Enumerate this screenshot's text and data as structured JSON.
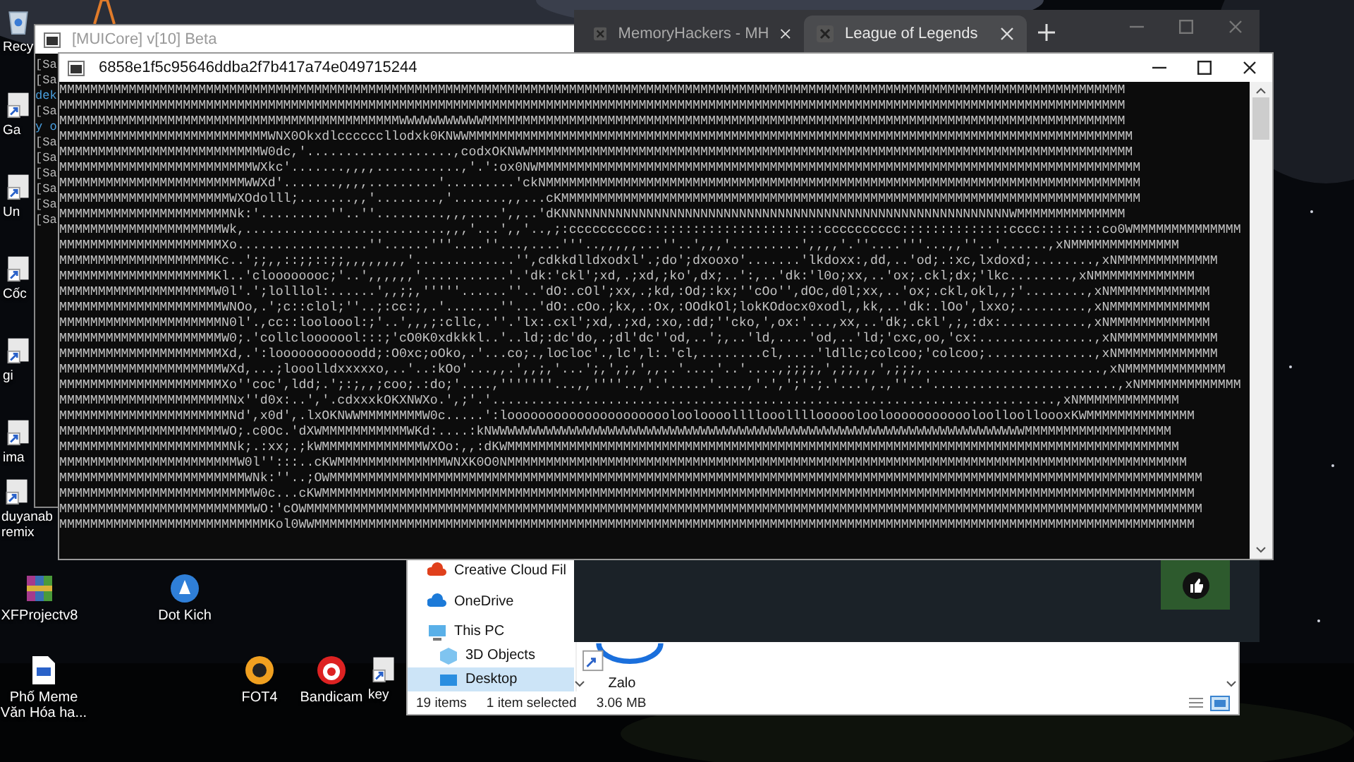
{
  "desktop": {
    "icons": [
      {
        "kind": "outline"
      },
      {
        "label": "Recy",
        "kind": "bin"
      },
      {
        "label": "Ga",
        "kind": "shortcut"
      },
      {
        "label": "Un",
        "kind": "shortcut"
      },
      {
        "label": "Cốc",
        "kind": "shortcut"
      },
      {
        "label": "gi",
        "kind": "shortcut"
      },
      {
        "label": "ima",
        "kind": "shortcut"
      },
      {
        "label": "duyanab remix",
        "kind": "shortcut"
      },
      {
        "label": "XFProjectv8",
        "kind": "archive"
      },
      {
        "label": "Dot Kich",
        "kind": "globe"
      },
      {
        "label": "Phố Meme Văn Hóa ha...",
        "kind": "document"
      },
      {
        "label": "FOT4",
        "kind": "circle"
      },
      {
        "label": "Bandicam",
        "kind": "record"
      },
      {
        "label": "key",
        "kind": "shortcut"
      }
    ]
  },
  "background_console": {
    "title": "[MUICore] v[10] Beta",
    "lines": [
      {
        "text": "[Sa",
        "kind": "log"
      },
      {
        "text": "[Sa",
        "kind": "log"
      },
      {
        "text": "dek",
        "kind": "info"
      },
      {
        "text": "[Sa",
        "kind": "log"
      },
      {
        "text": "y o",
        "kind": "info"
      },
      {
        "text": "[Sa",
        "kind": "log"
      },
      {
        "text": "[Sa",
        "kind": "log"
      },
      {
        "text": "[Sa",
        "kind": "log"
      },
      {
        "text": "[Sa",
        "kind": "log"
      },
      {
        "text": "[Sa",
        "kind": "log"
      },
      {
        "text": "[Sa",
        "kind": "log"
      }
    ]
  },
  "browser": {
    "tabs": [
      {
        "title": "MemoryHackers - MH",
        "selected": false
      },
      {
        "title": "League of Legends",
        "selected": true
      }
    ]
  },
  "explorer": {
    "nav_items": [
      {
        "label": "Creative Cloud Fil",
        "kind": "creative",
        "selected": false
      },
      {
        "label": "OneDrive",
        "kind": "onedrive",
        "selected": false
      },
      {
        "label": "This PC",
        "kind": "pc",
        "selected": false
      },
      {
        "label": "3D Objects",
        "kind": "objects",
        "selected": false
      },
      {
        "label": "Desktop",
        "kind": "desktop",
        "selected": true
      }
    ],
    "files": [
      {
        "name": "Zalo"
      }
    ],
    "status_bar": {
      "item_count": "19 items",
      "selection": "1 item selected",
      "size": "3.06 MB"
    }
  },
  "console": {
    "title": "6858e1f5c95646ddba2f7b417a74e049715244",
    "lines": [
      "MMMMMMMMMMMMMMMMMMMMMMMMMMMMMMMMMMMMMMMMMMMMMMMMMMMMMMMMMMMMMMMMMMMMMMMMMMMMMMMMMMMMMMMMMMMMMMMMMMMMMMMMMMMMMMMMMMMMMMMMMMMMMMMMMMMMMMMMMM",
      "MMMMMMMMMMMMMMMMMMMMMMMMMMMMMMMMMMMMMMMMMMMMMMMMMMMMMMMMMMMMMMMMMMMMMMMMMMMMMMMMMMMMMMMMMMMMMMMMMMMMMMMMMMMMMMMMMMMMMMMMMMMMMMMMMMMMMMMMMM",
      "MMMMMMMMMMMMMMMMMMMMMMMMMMMMMMMMMMMMMMMMMMMMWWWWWWWWWWWMMMMMMMMMMMMMMMMMMMMMMMMMMMMMMMMMMMMMMMMMMMMMMMMMMMMMMMMMMMMMMMMMMMMMMMMMMMMMMMMMMM",
      "MMMMMMMMMMMMMMMMMMMMMMMMMMMWNX0Okxdlccccccllodxk0KNWWMMMMMMMMMMMMMMMMMMMMMMMMMMMMMMMMMMMMMMMMMMMMMMMMMMMMMMMMMMMMMMMMMMMMMMMMMMMMMMMMMMMMMM",
      "MMMMMMMMMMMMMMMMMMMMMMMMMMW0dc,'...................,codxOKNWWMMMMMMMMMMMMMMMMMMMMMMMMMMMMMMMMMMMMMMMMMMMMMMMMMMMMMMMMMMMMMMMMMMMMMMMMMMMMMM",
      "MMMMMMMMMMMMMMMMMMMMMMMMMWXkc'.......,,,,...........,'.':ox0NWMMMMMMMMMMMMMMMMMMMMMMMMMMMMMMMMMMMMMMMMMMMMMMMMMMMMMMMMMMMMMMMMMMMMMMMMMMMMMM",
      "MMMMMMMMMMMMMMMMMMMMMMMMWWXd'.......,,,,.........'.........'ckNMMMMMMMMMMMMMMMMMMMMMMMMMMMMMMMMMMMMMMMMMMMMMMMMMMMMMMMMMMMMMMMMMMMMMMMMMMMMM",
      "MMMMMMMMMMMMMMMMMMMMMMWXOdolll;.......,,'........,'.......,,...cKMMMMMMMMMMMMMMMMMMMMMMMMMMMMMMMMMMMMMMMMMMMMMMMMMMMMMMMMMMMMMMMMMMMMMMMMMMM",
      "MMMMMMMMMMMMMMMMMMMMMMNk:'.........''..''.........,,,....',,..'dKNNNNNNNNNNNNNNNNNNNNNNNNNNNNNNNNNNNNNNNNNNNNNNNNNNNNNNNNNNWMMMMMMMMMMMMMM",
      "MMMMMMMMMMMMMMMMMMMMMWk,..........................,,,'...',,'..,;:cccccccccc:::::::::::::::::::::::cccccccccc::::::::::::::cccc::::::::co0WMMMMMMMMMMMMMM",
      "MMMMMMMMMMMMMMMMMMMMMXo.................''......'''....''...,....'''..,,,,,...''..',,,'.........',,,,'.''....'''...,,''..'......,xNMMMMMMMMMMMMMM",
      "MMMMMMMMMMMMMMMMMMMMKc..';;,,::;;::;;,,,,,,,,'.............'',cdkkdlldxodxl'.;do';dxooxo'.......'lkdoxx:,dd,..'od;.:xc,lxdoxd;........,xNMMMMMMMMMMMMM",
      "MMMMMMMMMMMMMMMMMMMMKl..'cloooooooc;'..',,,,,,'...........'.'dk:'ckl';xd,.;xd,;ko',dx;..':,..'dk:'l0o;xx,..'ox;.ckl;dx;'lkc........,xNMMMMMMMMMMMMM",
      "MMMMMMMMMMMMMMMMMMMMW0l'.';lolllol:......',,;;,'''''......''..'dO:.cOl';xx,.;kd,:Od;:kx;''cOo'',dOc,d0l;xx,..'ox;.ckl,okl,,;'........,xNMMMMMMMMMMMMM",
      "MMMMMMMMMMMMMMMMMMMMMWNOo,.';c::clol;''..;:cc:;,.'.......''...'dO:.cOo.;kx,.:Ox,:OOdkOl;lokKOdocx0xodl,,kk,..'dk:.lOo',lxxo;.........,xNMMMMMMMMMMMMM",
      "MMMMMMMMMMMMMMMMMMMMMN0l'.,cc::looloool:;'..',,,;:cllc,.''.'lx:.cxl';xd,.;xd,:xo,:dd;''cko,',ox:'...,xx,..'dk;.ckl',;,:dx:...........,xNMMMMMMMMMMMMM",
      "MMMMMMMMMMMMMMMMMMMMMW0;.'collclooooool:::;'cO0K0xdkkkl..'..ld;:dc'do,.;dl'dc''od,..';,..'ld,....'od,..'ld;'cxc,oo,'cx:...............,xNMMMMMMMMMMMMM",
      "MMMMMMMMMMMMMMMMMMMMMXd,.':looooooooooodd;:O0xc;oOko,.'...co;.,locloc'.,lc',l:.'cl,........cl,....'ldllc;colcoo;'colcoo;..............,xNMMMMMMMMMMMMM",
      "MMMMMMMMMMMMMMMMMMMMMWXd,...;looolldxxxxxo,..'..:kOo'...,,.',,;,'...';,',;,',,..'....'..'....,;;;;,',;;,,,',;;;,.......................,xNMMMMMMMMMMMMM",
      "MMMMMMMMMMMMMMMMMMMMMXo''coc',ldd;.';:;,,;coo;.:do;'....,'''''''...,,''''..,'.'.....'....,'.',';'.;.'...',.,''..'........................,xNMMMMMMMMMMMMM",
      "MMMMMMMMMMMMMMMMMMMMMMNx''d0x:..','.cdxxxkOKXNWXo.',;'.'.........................................................................,xNMMMMMMMMMMMMM",
      "MMMMMMMMMMMMMMMMMMMMMMNd',x0d',.lxOKNWWMMMMMMMMW0c.....':looooooooooooooooooooolooloooollllooollllooooolooloooooooooooloolloolloooxKWMMMMMMMMMMMMMM",
      "MMMMMMMMMMMMMMMMMMMMMWO;.c0Oc.'dXWMMMMMMMMMMMWKd:....:kNWWWWWWWWWWWWWWWWWWWWWWWWWWWWWWWWWWWWWWWWWWWWWWWWWWWWWWWWWWWWWWWWWWWWWMMMMMMMMMMMMMMMMMMM",
      "MMMMMMMMMMMMMMMMMMMMMMNk;.:xx;.;kWMMMMMMMMMMMMMWXOo:,,:dKWMMMMMMMMMMMMMMMMMMMMMMMMMMMMMMMMMMMMMMMMMMMMMMMMMMMMMMMMMMMMMMMMMMMMMMMMMMMMMMMMMMMMMMM",
      "MMMMMMMMMMMMMMMMMMMMMMMW0l'':::..cKWMMMMMMMMMMMMMMWNXK0O0NMMMMMMMMMMMMMMMMMMMMMMMMMMMMMMMMMMMMMMMMMMMMMMMMMMMMMMMMMMMMMMMMMMMMMMMMMMMMMMMMMMMMMMMM",
      "MMMMMMMMMMMMMMMMMMMMMMMMWNk:''..;OWMMMMMMMMMMMMMMMMMMMMMMMMMMMMMMMMMMMMMMMMMMMMMMMMMMMMMMMMMMMMMMMMMMMMMMMMMMMMMMMMMMMMMMMMMMMMMMMMMMMMMMMMMMMMMMMMM",
      "MMMMMMMMMMMMMMMMMMMMMMMMMW0c...cKWMMMMMMMMMMMMMMMMMMMMMMMMMMMMMMMMMMMMMMMMMMMMMMMMMMMMMMMMMMMMMMMMMMMMMMMMMMMMMMMMMMMMMMMMMMMMMMMMMMMMMMMMMMMMMMMMM",
      "MMMMMMMMMMMMMMMMMMMMMMMMMWO:'cOWMMMMMMMMMMMMMMMMMMMMMMMMMMMMMMMMMMMMMMMMMMMMMMMMMMMMMMMMMMMMMMMMMMMMMMMMMMMMMMMMMMMMMMMMMMMMMMMMMMMMMMMMMMMMMMMMMMMM",
      "MMMMMMMMMMMMMMMMMMMMMMMMMMMKol0WWMMMMMMMMMMMMMMMMMMMMMMMMMMMMMMMMMMMMMMMMMMMMMMMMMMMMMMMMMMMMMMMMMMMMMMMMMMMMMMMMMMMMMMMMMMMMMMMMMMMMMMMMMMMMMMMMMM"
    ]
  }
}
